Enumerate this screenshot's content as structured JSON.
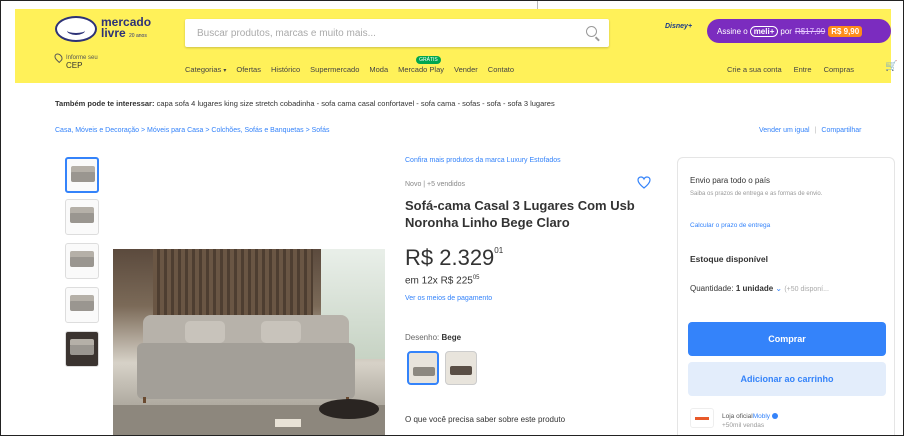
{
  "header": {
    "logo_line1": "mercado",
    "logo_line2": "livre",
    "logo_tag": "20 anos",
    "search_placeholder": "Buscar produtos, marcas e muito mais...",
    "promo": {
      "prefix": "Assine o",
      "brand": "meli+",
      "middle": "por",
      "old_price": "R$17,99",
      "new_price": "R$ 9,90"
    },
    "disney_label": "Disney+",
    "location_label": "Informe seu",
    "location_value": "CEP",
    "nav": {
      "categories": "Categorias",
      "offers": "Ofertas",
      "history": "Histórico",
      "supermarket": "Supermercado",
      "fashion": "Moda",
      "mercado_play": "Mercado Play",
      "mercado_play_badge": "GRÁTIS",
      "sell": "Vender",
      "contact": "Contato"
    },
    "account": {
      "create": "Crie a sua conta",
      "login": "Entre",
      "purchases": "Compras"
    }
  },
  "related": {
    "label": "Também pode te interessar:",
    "items": "capa sofa 4 lugares king size stretch cobadinha - sofa cama casal confortavel - sofa cama - sofas - sofa - sofa 3 lugares"
  },
  "breadcrumb": "Casa, Móveis e Decoração  >  Móveis para Casa  >  Colchões, Sofás e Banquetas  >  Sofás",
  "actions": {
    "sell_same": "Vender um igual",
    "share": "Compartilhar"
  },
  "product": {
    "brand_link": "Confira mais produtos da marca Luxury Estofados",
    "condition": "Novo  |  +5 vendidos",
    "title": "Sofá-cama Casal 3 Lugares Com Usb Noronha Linho Bege Claro",
    "price_main": "R$ 2.329",
    "price_cents": "01",
    "installments_prefix": "em 12x R$ 225",
    "installments_cents": "05",
    "payment_link": "Ver os meios de pagamento",
    "design_label": "Desenho:",
    "design_value": "Bege",
    "info_title": "O que você precisa saber sobre este produto"
  },
  "buybox": {
    "ship_title": "Envio para todo o país",
    "ship_desc": "Saiba os prazos de entrega e as formas de envio.",
    "ship_link": "Calcular o prazo de entrega",
    "stock": "Estoque disponível",
    "quantity_label": "Quantidade:",
    "quantity_value": "1 unidade",
    "quantity_avail": "(+50 disponí...",
    "buy": "Comprar",
    "add_cart": "Adicionar ao carrinho",
    "store_line1_prefix": "Loja oficial",
    "store_brand": "Mobly",
    "store_sales": "+50mil vendas"
  }
}
